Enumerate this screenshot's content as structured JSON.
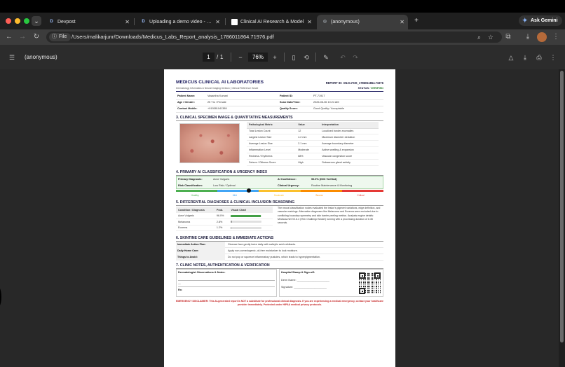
{
  "browser": {
    "tabs": [
      {
        "label": "Devpost",
        "favicon": "D"
      },
      {
        "label": "Uploading a demo video - Dev",
        "favicon": "D"
      },
      {
        "label": "Clinical AI Research & Model",
        "favicon": ""
      },
      {
        "label": "(anonymous)",
        "favicon": ""
      }
    ],
    "active_tab_index": 3,
    "ask_gemini_label": "Ask Gemini",
    "address_chip": "File",
    "url": "/Users/malikarjunr/Downloads/Medicus_Labs_Report_analysis_1786011864.71976.pdf",
    "new_tab_symbol": "+",
    "colors": {
      "tabbar": "#1f1f1f",
      "toolbar": "#3c3c3c",
      "accent": "#8ab4f8"
    }
  },
  "pdf_toolbar": {
    "title": "(anonymous)",
    "page_current": "1",
    "page_separator": "/",
    "page_total": "1",
    "zoom_minus": "−",
    "zoom": "76%",
    "zoom_plus": "+"
  },
  "report": {
    "lab_name": "MEDICUS CLINICAL AI LABORATORIES",
    "lab_subtitle": "Dermatology Informatics & Neural Imaging Division | Clinical Reference Grade",
    "report_id_label": "REPORT ID: ANALYSIS_1786011864.71976",
    "status_label": "STATUS:",
    "status_value": "VERIFIED",
    "patient": {
      "name_label": "Patient Name:",
      "name": "Vasantha Kumari",
      "id_label": "Patient ID:",
      "id": "PT-71917",
      "age_label": "Age / Gender:",
      "age": "25 Yrs / Female",
      "scan_label": "Scan Date/Time:",
      "scan": "2026-06-06 10:24 AM",
      "mobile_label": "Contact Mobile:",
      "mobile": "+919381041389",
      "quality_label": "Quality Score:",
      "quality": "Good Quality / Acceptable"
    },
    "section3_title": "3. CLINICAL SPECIMEN IMAGE & QUANTITATIVE MEASUREMENTS",
    "metrics_headers": [
      "Pathological Metric",
      "Value",
      "Interpretation"
    ],
    "metrics": [
      [
        "Total Lesion Count",
        "12",
        "Localized border anomalies"
      ],
      [
        "Largest Lesion Size",
        "4.2 mm",
        "Maximum diameter deviation"
      ],
      [
        "Average Lesion Size",
        "2.1 mm",
        "Average boundary diameter"
      ],
      [
        "Inflammation Level",
        "Moderate",
        "Active swelling & expansion"
      ],
      [
        "Redness / Erythema",
        "68%",
        "Vascular congestion score"
      ],
      [
        "Sebum / Oiliness Score",
        "High",
        "Sebaceous gland activity"
      ]
    ],
    "section4_title": "4. PRIMARY AI CLASSIFICATION & URGENCY INDEX",
    "classification": {
      "diagnosis_label": "Primary Diagnosis:",
      "diagnosis": "Acne Vulgaris",
      "confidence_label": "AI Confidence:",
      "confidence": "96.0% (ISIC Verified)",
      "risk_label": "Risk Classification:",
      "risk": "Low Risk / Optimal",
      "urgency_label": "Clinical Urgency:",
      "urgency": "Routine Maintenance & Monitoring"
    },
    "urgency_scale": {
      "labels": [
        "Healthy",
        "Mild",
        "Moderate",
        "Severe",
        "Critical"
      ],
      "colors": [
        "#4caf50",
        "#42a5f5",
        "#fbc02d",
        "#fb8c00",
        "#e53935"
      ],
      "marker_fraction": 0.35
    },
    "section5_title": "5. DIFFERENTIAL DIAGNOSES & CLINICAL INCLUSION REASONING",
    "ddx_headers": [
      "Condition / Diagnosis",
      "Prob.",
      "Visual Chart"
    ],
    "ddx": [
      {
        "name": "Acne Vulgaris",
        "prob": "96.0%",
        "fraction": 0.96,
        "color": "#43a047"
      },
      {
        "name": "Melanoma",
        "prob": "2.8%",
        "fraction": 0.028,
        "color": "#9e9e9e"
      },
      {
        "name": "Eczema",
        "prob": "1.2%",
        "fraction": 0.012,
        "color": "#9e9e9e"
      }
    ],
    "reasoning": "The neural classification nodes evaluated the lesion's pigment variations, edge definition, and vascular markings. Alternative diagnoses like Melanoma and Eczema were excluded due to conflicting boundary symmetry and skin barrier peeling metrics. Analysis engine details: Medicus-Net V2.6.4 (ISIC Challenge Model) running with a processing duration of 0.45 seconds.",
    "section6_title": "6. SKINTINE CARE GUIDELINES & IMMEDIATE ACTIONS",
    "care": [
      {
        "label": "Immediate Action Plan:",
        "value": "Cleanse face gently twice daily with salicylic acid exfoliants."
      },
      {
        "label": "Daily Home Care:",
        "value": "Apply non-comedogenic, oil-free moisturizer to lock moisture."
      },
      {
        "label": "Things to Avoid:",
        "value": "Do not pop or squeeze inflammatory pustules, which leads to hyperpigmentation."
      }
    ],
    "section7_title": "7. CLINIC NOTES, AUTHENTICATION & VERIFICATION",
    "notes_label": "Dermatologist Observations & Notes:",
    "notes_dash": "—",
    "rx_label": "Rx:",
    "stamp_label": "Hospital Stamp & Sign-off:",
    "derm_name_label": "Derm Name: ______________________",
    "signature_label": "Signature: ______________________",
    "disclaimer": "EMERGENCY DISCLAIMER: This AI-generated report is NOT a substitute for professional clinical diagnosis. If you are experiencing a medical emergency, contact your healthcare provider immediately. Protected under HIPAA medical privacy protocols."
  }
}
